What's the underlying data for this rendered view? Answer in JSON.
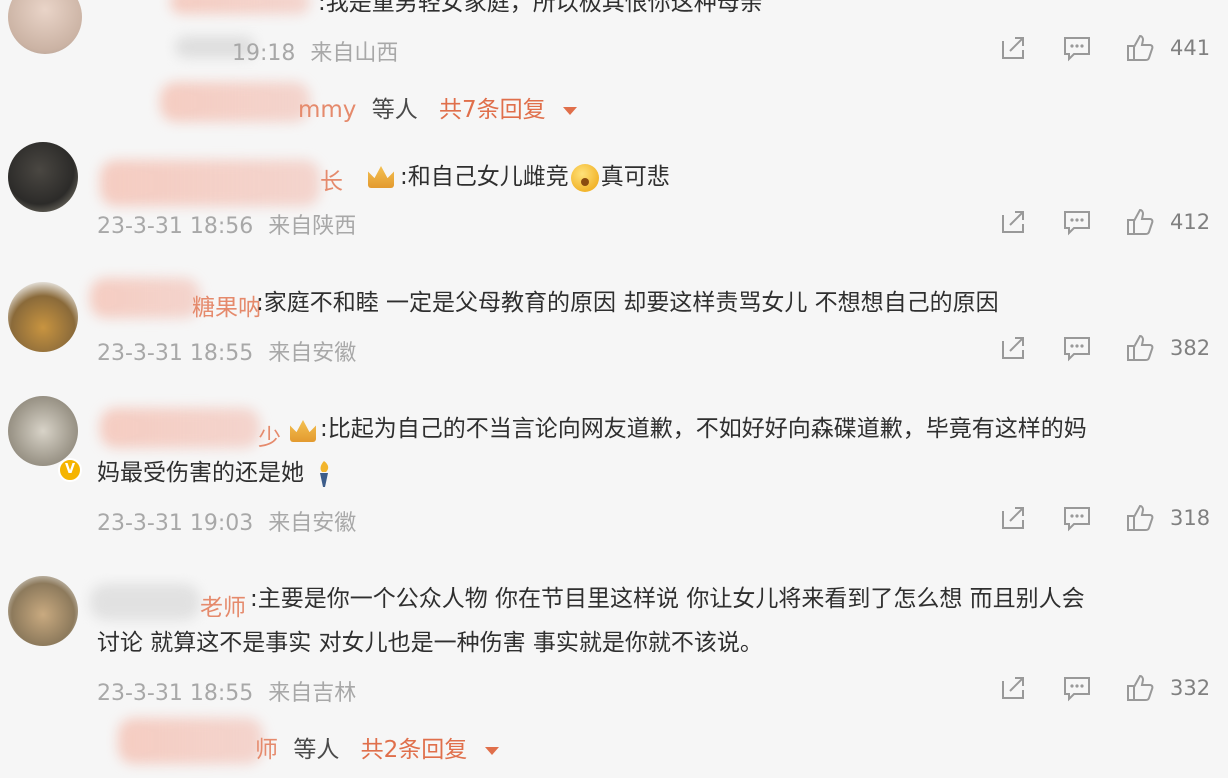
{
  "comments": [
    {
      "nick_tail": "",
      "content": ":我是重男轻女家庭，所以极其恨你这种母亲",
      "time": "19:18",
      "location": "来自山西",
      "likes": "441"
    },
    {
      "nick_tail": "长",
      "content": ":和自己女儿雌竞",
      "content_after_emoji": "真可悲",
      "time": "23-3-31 18:56",
      "location": "来自陕西",
      "likes": "412"
    },
    {
      "nick_tail": "糖果呐",
      "content": ":家庭不和睦 一定是父母教育的原因 却要这样责骂女儿 不想想自己的原因",
      "time": "23-3-31 18:55",
      "location": "来自安徽",
      "likes": "382"
    },
    {
      "nick_tail": "少",
      "content_line1": ":比起为自己的不当言论向网友道歉，不如好好向森碟道歉，毕竟有这样的妈",
      "content_line2": "妈最受伤害的还是她",
      "time": "23-3-31 19:03",
      "location": "来自安徽",
      "likes": "318"
    },
    {
      "nick_tail": "老师",
      "content_line1": ":主要是你一个公众人物 你在节目里这样说 你让女儿将来看到了怎么想 而且别人会",
      "content_line2": "讨论 就算这不是事实 对女儿也是一种伤害 事实就是你就不该说。",
      "time": "23-3-31 18:55",
      "location": "来自吉林",
      "likes": "332"
    }
  ],
  "replies": [
    {
      "name_tail": "mmy",
      "people": "等人",
      "total": "共7条回复"
    },
    {
      "name_tail": "师",
      "people": "等人",
      "total": "共2条回复"
    }
  ],
  "icons": {
    "share": "share-icon",
    "comment": "comment-icon",
    "like": "thumbs-up-icon"
  },
  "colors": {
    "accent": "#e06f4b",
    "nickname": "#e58a6c",
    "meta": "#a8a8a8"
  }
}
